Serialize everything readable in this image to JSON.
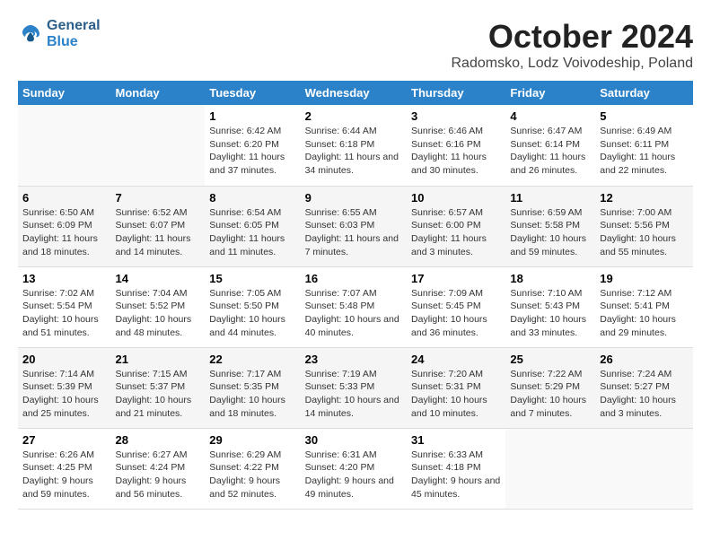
{
  "header": {
    "logo_general": "General",
    "logo_blue": "Blue",
    "month_title": "October 2024",
    "location": "Radomsko, Lodz Voivodeship, Poland"
  },
  "days_of_week": [
    "Sunday",
    "Monday",
    "Tuesday",
    "Wednesday",
    "Thursday",
    "Friday",
    "Saturday"
  ],
  "weeks": [
    [
      {
        "day": "",
        "info": ""
      },
      {
        "day": "",
        "info": ""
      },
      {
        "day": "1",
        "info": "Sunrise: 6:42 AM\nSunset: 6:20 PM\nDaylight: 11 hours and 37 minutes."
      },
      {
        "day": "2",
        "info": "Sunrise: 6:44 AM\nSunset: 6:18 PM\nDaylight: 11 hours and 34 minutes."
      },
      {
        "day": "3",
        "info": "Sunrise: 6:46 AM\nSunset: 6:16 PM\nDaylight: 11 hours and 30 minutes."
      },
      {
        "day": "4",
        "info": "Sunrise: 6:47 AM\nSunset: 6:14 PM\nDaylight: 11 hours and 26 minutes."
      },
      {
        "day": "5",
        "info": "Sunrise: 6:49 AM\nSunset: 6:11 PM\nDaylight: 11 hours and 22 minutes."
      }
    ],
    [
      {
        "day": "6",
        "info": "Sunrise: 6:50 AM\nSunset: 6:09 PM\nDaylight: 11 hours and 18 minutes."
      },
      {
        "day": "7",
        "info": "Sunrise: 6:52 AM\nSunset: 6:07 PM\nDaylight: 11 hours and 14 minutes."
      },
      {
        "day": "8",
        "info": "Sunrise: 6:54 AM\nSunset: 6:05 PM\nDaylight: 11 hours and 11 minutes."
      },
      {
        "day": "9",
        "info": "Sunrise: 6:55 AM\nSunset: 6:03 PM\nDaylight: 11 hours and 7 minutes."
      },
      {
        "day": "10",
        "info": "Sunrise: 6:57 AM\nSunset: 6:00 PM\nDaylight: 11 hours and 3 minutes."
      },
      {
        "day": "11",
        "info": "Sunrise: 6:59 AM\nSunset: 5:58 PM\nDaylight: 10 hours and 59 minutes."
      },
      {
        "day": "12",
        "info": "Sunrise: 7:00 AM\nSunset: 5:56 PM\nDaylight: 10 hours and 55 minutes."
      }
    ],
    [
      {
        "day": "13",
        "info": "Sunrise: 7:02 AM\nSunset: 5:54 PM\nDaylight: 10 hours and 51 minutes."
      },
      {
        "day": "14",
        "info": "Sunrise: 7:04 AM\nSunset: 5:52 PM\nDaylight: 10 hours and 48 minutes."
      },
      {
        "day": "15",
        "info": "Sunrise: 7:05 AM\nSunset: 5:50 PM\nDaylight: 10 hours and 44 minutes."
      },
      {
        "day": "16",
        "info": "Sunrise: 7:07 AM\nSunset: 5:48 PM\nDaylight: 10 hours and 40 minutes."
      },
      {
        "day": "17",
        "info": "Sunrise: 7:09 AM\nSunset: 5:45 PM\nDaylight: 10 hours and 36 minutes."
      },
      {
        "day": "18",
        "info": "Sunrise: 7:10 AM\nSunset: 5:43 PM\nDaylight: 10 hours and 33 minutes."
      },
      {
        "day": "19",
        "info": "Sunrise: 7:12 AM\nSunset: 5:41 PM\nDaylight: 10 hours and 29 minutes."
      }
    ],
    [
      {
        "day": "20",
        "info": "Sunrise: 7:14 AM\nSunset: 5:39 PM\nDaylight: 10 hours and 25 minutes."
      },
      {
        "day": "21",
        "info": "Sunrise: 7:15 AM\nSunset: 5:37 PM\nDaylight: 10 hours and 21 minutes."
      },
      {
        "day": "22",
        "info": "Sunrise: 7:17 AM\nSunset: 5:35 PM\nDaylight: 10 hours and 18 minutes."
      },
      {
        "day": "23",
        "info": "Sunrise: 7:19 AM\nSunset: 5:33 PM\nDaylight: 10 hours and 14 minutes."
      },
      {
        "day": "24",
        "info": "Sunrise: 7:20 AM\nSunset: 5:31 PM\nDaylight: 10 hours and 10 minutes."
      },
      {
        "day": "25",
        "info": "Sunrise: 7:22 AM\nSunset: 5:29 PM\nDaylight: 10 hours and 7 minutes."
      },
      {
        "day": "26",
        "info": "Sunrise: 7:24 AM\nSunset: 5:27 PM\nDaylight: 10 hours and 3 minutes."
      }
    ],
    [
      {
        "day": "27",
        "info": "Sunrise: 6:26 AM\nSunset: 4:25 PM\nDaylight: 9 hours and 59 minutes."
      },
      {
        "day": "28",
        "info": "Sunrise: 6:27 AM\nSunset: 4:24 PM\nDaylight: 9 hours and 56 minutes."
      },
      {
        "day": "29",
        "info": "Sunrise: 6:29 AM\nSunset: 4:22 PM\nDaylight: 9 hours and 52 minutes."
      },
      {
        "day": "30",
        "info": "Sunrise: 6:31 AM\nSunset: 4:20 PM\nDaylight: 9 hours and 49 minutes."
      },
      {
        "day": "31",
        "info": "Sunrise: 6:33 AM\nSunset: 4:18 PM\nDaylight: 9 hours and 45 minutes."
      },
      {
        "day": "",
        "info": ""
      },
      {
        "day": "",
        "info": ""
      }
    ]
  ]
}
